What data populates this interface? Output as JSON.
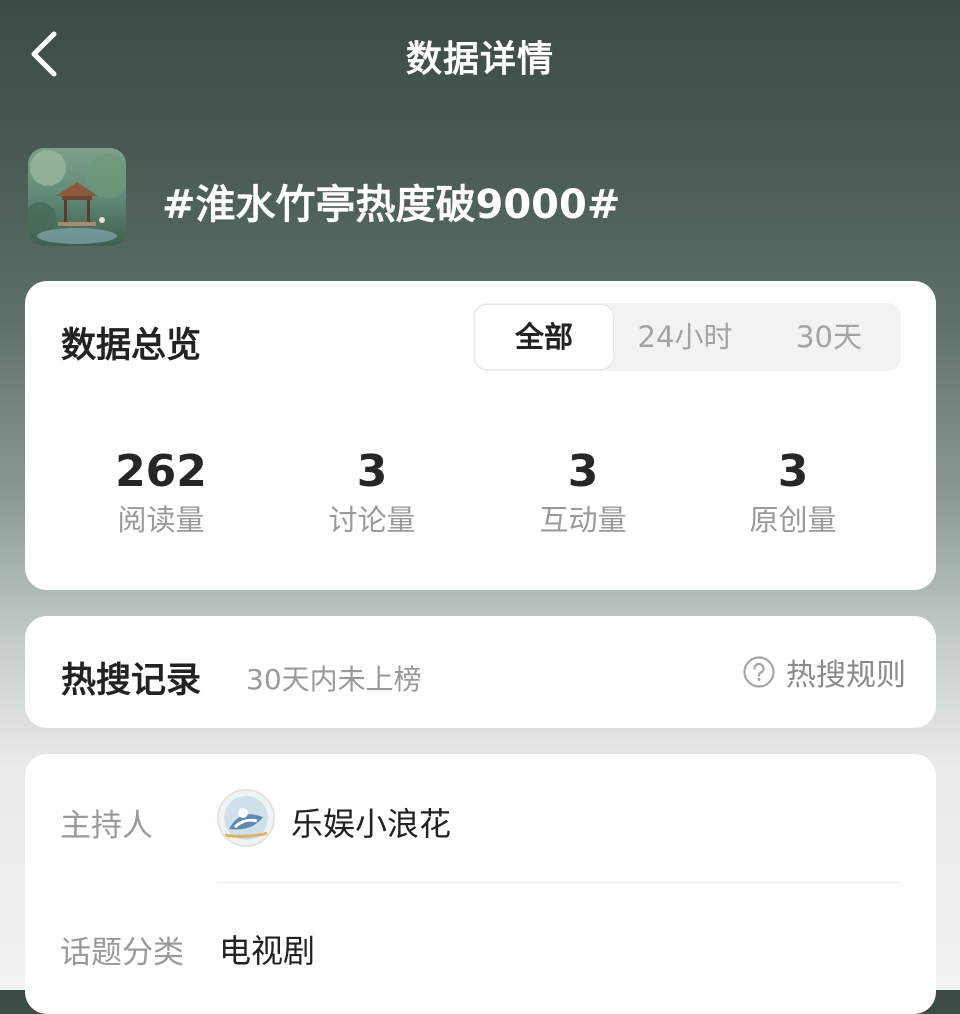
{
  "header": {
    "title": "数据详情",
    "back_icon": "back-chevron-icon"
  },
  "topic": {
    "title": "#淮水竹亭热度破9000#",
    "thumbnail": "pavilion-landscape-thumbnail"
  },
  "overview": {
    "title": "数据总览",
    "tabs": [
      {
        "label": "全部",
        "selected": true
      },
      {
        "label": "24小时",
        "selected": false
      },
      {
        "label": "30天",
        "selected": false
      }
    ],
    "stats": [
      {
        "value": "262",
        "label": "阅读量"
      },
      {
        "value": "3",
        "label": "讨论量"
      },
      {
        "value": "3",
        "label": "互动量"
      },
      {
        "value": "3",
        "label": "原创量"
      }
    ]
  },
  "hot_search": {
    "title": "热搜记录",
    "subtitle": "30天内未上榜",
    "rule_label": "热搜规则",
    "rule_icon": "question-circle-icon"
  },
  "info": {
    "host_label": "主持人",
    "host_name": "乐娱小浪花",
    "category_label": "话题分类",
    "category_value": "电视剧"
  },
  "colors": {
    "primary_text": "#222222",
    "secondary_text": "#9a9a9a",
    "card_background": "#ffffff"
  }
}
